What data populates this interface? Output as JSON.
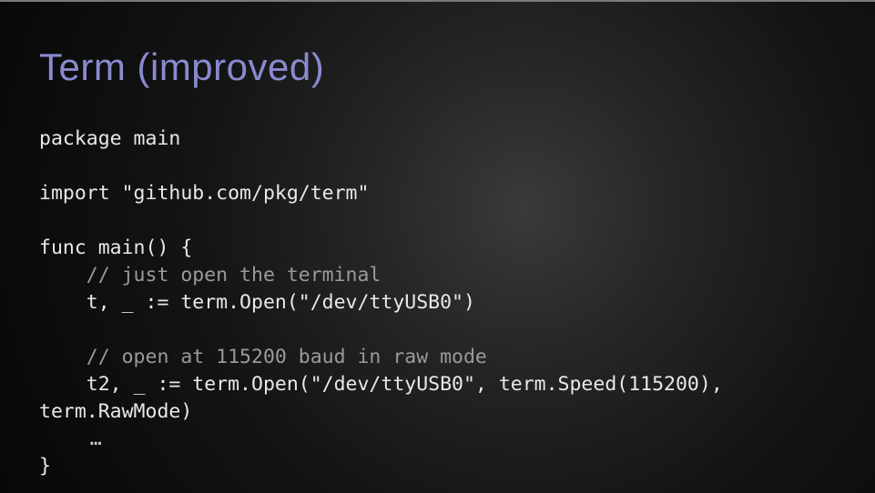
{
  "slide": {
    "title": "Term (improved)",
    "code": {
      "l1": "package main",
      "blank1": "",
      "l2": "import \"github.com/pkg/term\"",
      "blank2": "",
      "l3": "func main() {",
      "c1": "    // just open the terminal",
      "l4": "    t, _ := term.Open(\"/dev/ttyUSB0\")",
      "blank3": "",
      "c2": "    // open at 115200 baud in raw mode",
      "l5": "    t2, _ := term.Open(\"/dev/ttyUSB0\", term.Speed(115200),",
      "l6": "term.RawMode)",
      "ellipsis": "    …",
      "l7": "}"
    }
  }
}
